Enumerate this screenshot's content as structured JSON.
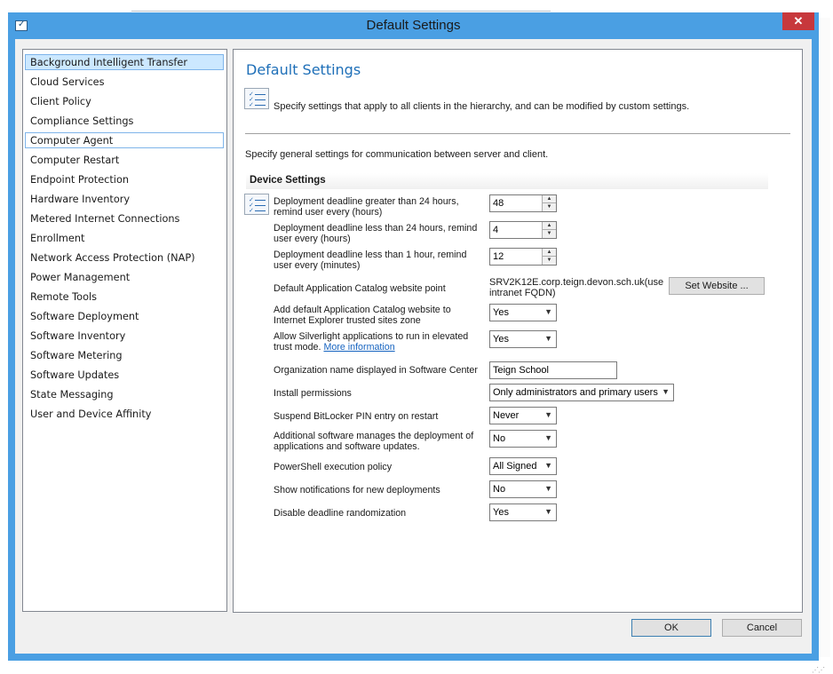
{
  "window": {
    "title": "Default Settings",
    "close_glyph": "✕"
  },
  "nav": {
    "items": [
      "Background Intelligent Transfer",
      "Cloud Services",
      "Client Policy",
      "Compliance Settings",
      "Computer Agent",
      "Computer Restart",
      "Endpoint Protection",
      "Hardware Inventory",
      "Metered Internet Connections",
      "Enrollment",
      "Network Access Protection (NAP)",
      "Power Management",
      "Remote Tools",
      "Software Deployment",
      "Software Inventory",
      "Software Metering",
      "Software Updates",
      "State Messaging",
      "User and Device Affinity"
    ],
    "selected": "Background Intelligent Transfer",
    "focused": "Computer Agent"
  },
  "panel": {
    "title": "Default Settings",
    "description": "Specify settings that apply to all clients in the hierarchy, and can be modified by custom settings.",
    "general_text": "Specify general settings for communication between server and client.",
    "section_title": "Device Settings",
    "settings": {
      "deadline_24plus": {
        "label": "Deployment deadline greater than 24 hours, remind user every (hours)",
        "value": "48"
      },
      "deadline_24less": {
        "label": "Deployment deadline less than 24 hours, remind user every (hours)",
        "value": "4"
      },
      "deadline_1h": {
        "label": "Deployment deadline less than 1 hour, remind user every (minutes)",
        "value": "12"
      },
      "catalog_point": {
        "label": "Default Application Catalog website point",
        "value": "SRV2K12E.corp.teign.devon.sch.uk(use intranet FQDN)",
        "button": "Set Website ..."
      },
      "catalog_trusted": {
        "label": "Add default Application Catalog website to Internet Explorer trusted sites zone",
        "value": "Yes"
      },
      "silverlight": {
        "label": "Allow Silverlight applications to run in elevated trust mode.",
        "link": "More information",
        "value": "Yes"
      },
      "org_name": {
        "label": "Organization name displayed in Software Center",
        "value": "Teign School"
      },
      "install_permissions": {
        "label": "Install permissions",
        "value": "Only administrators and primary users"
      },
      "bitlocker": {
        "label": "Suspend BitLocker PIN entry on restart",
        "value": "Never"
      },
      "additional_sw": {
        "label": "Additional software manages the deployment of applications and software updates.",
        "value": "No"
      },
      "powershell": {
        "label": "PowerShell execution policy",
        "value": "All Signed"
      },
      "notifications": {
        "label": "Show notifications for new deployments",
        "value": "No"
      },
      "randomization": {
        "label": "Disable deadline randomization",
        "value": "Yes"
      }
    }
  },
  "footer": {
    "ok": "OK",
    "cancel": "Cancel"
  },
  "colors": {
    "titlebar": "#4a9fe3",
    "close": "#c7383c",
    "selection": "#cce8ff",
    "heading": "#1e6fb8",
    "link": "#1764c0"
  },
  "icons": {
    "app": "checklist-icon",
    "settings": "checklist-icon",
    "close": "close-icon",
    "spin": "spinner-arrows-icon",
    "dropdown": "chevron-down-icon"
  }
}
